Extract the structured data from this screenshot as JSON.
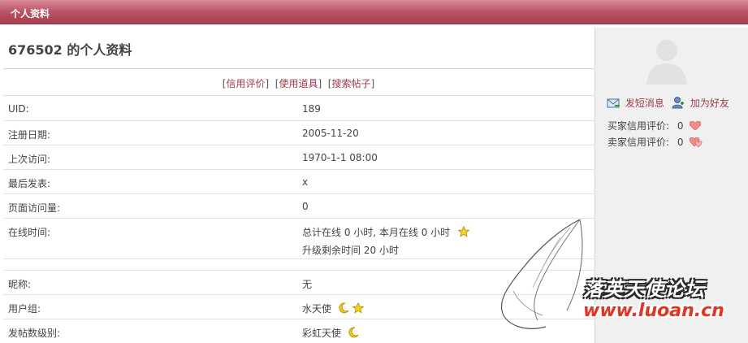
{
  "header": {
    "title": "个人资料"
  },
  "profile": {
    "title": "676502 的个人资料",
    "links": [
      "信用评价",
      "使用道具",
      "搜索帖子"
    ],
    "fields": [
      {
        "label": "UID:",
        "value": "189"
      },
      {
        "label": "注册日期:",
        "value": "2005-11-20"
      },
      {
        "label": "上次访问:",
        "value": "1970-1-1 08:00"
      },
      {
        "label": "最后发表:",
        "value": "x"
      },
      {
        "label": "页面访问量:",
        "value": "0"
      }
    ],
    "online": {
      "label": "在线时间:",
      "line1": "总计在线  0 小时, 本月在线  0 小时",
      "line2": "升级剩余时间  20 小时"
    },
    "fields2": [
      {
        "label": "昵称:",
        "value": "无"
      },
      {
        "label": "用户组:",
        "value": "水天使"
      },
      {
        "label": "发帖数级别:",
        "value": "彩虹天使"
      }
    ]
  },
  "sidebar": {
    "send_message": "发短消息",
    "add_friend": "加为好友",
    "buyer_label": "买家信用评价:",
    "buyer_value": "0",
    "seller_label": "卖家信用评价:",
    "seller_value": "0"
  },
  "watermark": {
    "line1": "落英天使论坛",
    "line2": "www.luoan.cn"
  },
  "colors": {
    "header": "#b84f5f",
    "link": "#a23a4a",
    "sidebar_bg": "#f0f0f0"
  }
}
